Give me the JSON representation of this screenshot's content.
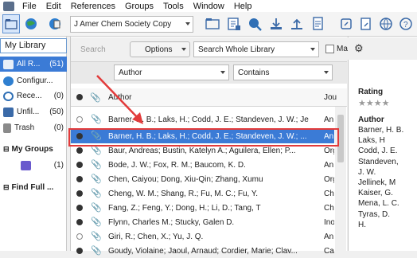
{
  "menu": [
    "File",
    "Edit",
    "References",
    "Groups",
    "Tools",
    "Window",
    "Help"
  ],
  "toolbar": {
    "style_value": "J Amer Chem Society Copy"
  },
  "left": {
    "header": "My Library",
    "groups": [
      {
        "label": "All R...",
        "count": "(51)"
      },
      {
        "label": "Configur...",
        "count": ""
      },
      {
        "label": "Rece...",
        "count": "(0)"
      },
      {
        "label": "Unfil...",
        "count": "(50)"
      },
      {
        "label": "Trash",
        "count": "(0)"
      }
    ],
    "my_groups": {
      "label": "My Groups",
      "child_count": "(1)"
    },
    "find_full": "Find Full ..."
  },
  "search": {
    "placeholder": "Search",
    "options_label": "Options",
    "scope": "Search Whole Library",
    "field": "Author",
    "operator": "Contains",
    "match_label": "Ma"
  },
  "table": {
    "header_author": "Author",
    "header_journal": "Jou",
    "rows": [
      {
        "author": "Barner, H. B.; Laks, H.; Codd, J. E.; Standeven, J. W.; Jel...",
        "journal": "An",
        "read": false
      },
      {
        "author": "Barner, H. B.; Laks, H.; Codd, J. E.; Standeven, J. W.; ...",
        "journal": "An",
        "read": true
      },
      {
        "author": "Baur, Andreas; Bustin, Katelyn A.; Aguilera, Ellen; P...",
        "journal": "Org",
        "read": true
      },
      {
        "author": "Bode, J. W.; Fox, R. M.; Baucom, K. D.",
        "journal": "An",
        "read": true
      },
      {
        "author": "Chen, Caiyou; Dong, Xiu-Qin; Zhang, Xumu",
        "journal": "Org",
        "read": true
      },
      {
        "author": "Cheng, W. M.; Shang, R.; Fu, M. C.; Fu, Y.",
        "journal": "Che",
        "read": true
      },
      {
        "author": "Fang, Z.; Feng, Y.; Dong, H.; Li, D.; Tang, T",
        "journal": "Che",
        "read": true
      },
      {
        "author": "Flynn, Charles M.; Stucky, Galen D.",
        "journal": "Ino",
        "read": true
      },
      {
        "author": "Giri, R.; Chen, X.; Yu, J. Q.",
        "journal": "An",
        "read": false
      },
      {
        "author": "Goudy, Violaine; Jaoul, Arnaud; Cordier, Marie; Clav...",
        "journal": "Ca",
        "read": true
      }
    ]
  },
  "right": {
    "rating_label": "Rating",
    "author_label": "Author",
    "authors": [
      "Barner, H. B.",
      "Laks, H",
      "Codd, J. E.",
      "Standeven,",
      "J. W.",
      "Jellinek, M",
      "Kaiser, G.",
      "Mena, L. C.",
      "Tyras, D.",
      "H."
    ]
  },
  "colors": {
    "accent": "#3b7bd6",
    "annotation": "#e23b3b"
  }
}
